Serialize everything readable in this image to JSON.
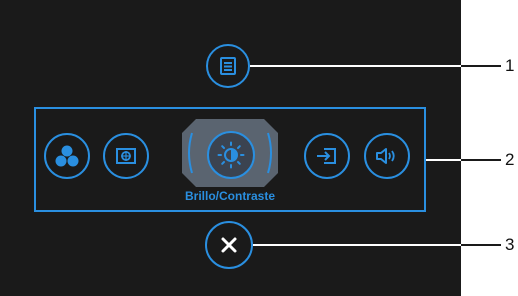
{
  "menu": {
    "top_icon": "menu-list-icon",
    "items": [
      {
        "icon": "color-circles-icon",
        "selected": false
      },
      {
        "icon": "display-settings-icon",
        "selected": false
      },
      {
        "icon": "brightness-contrast-icon",
        "selected": true,
        "label": "Brillo/Contraste"
      },
      {
        "icon": "input-source-icon",
        "selected": false
      },
      {
        "icon": "volume-icon",
        "selected": false
      }
    ],
    "close_icon": "close-x-icon"
  },
  "callouts": [
    "1",
    "2",
    "3"
  ],
  "colors": {
    "accent": "#2a8fe0",
    "background": "#1a1a1a",
    "selected_backdrop": "#5a6470"
  }
}
